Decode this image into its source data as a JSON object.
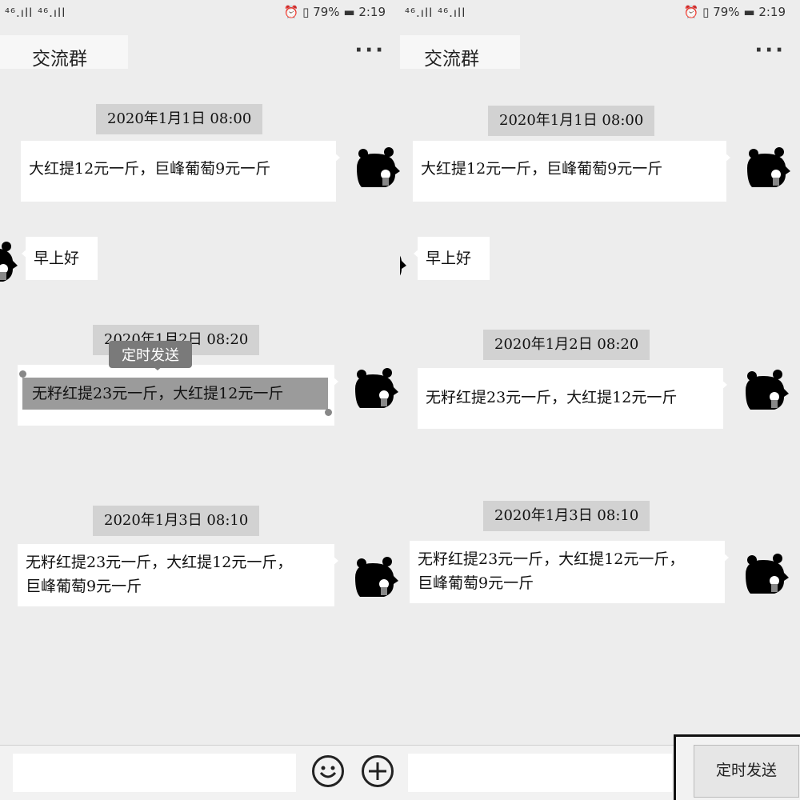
{
  "status": {
    "signal": "⁴⁶.ıll ⁴⁶.ıll",
    "battery_pct": "79%",
    "time": "2:19"
  },
  "chat": {
    "title": "交流群",
    "more_label": "···"
  },
  "timestamps": {
    "t1": "2020年1月1日 08:00",
    "t2": "2020年1月2日 08:20",
    "t3": "2020年1月3日 08:10"
  },
  "messages": {
    "m1": "大红提12元一斤，巨峰葡萄9元一斤",
    "m2": "早上好",
    "m3": "无籽红提23元一斤，大红提12元一斤",
    "m4_line1": "无籽红提23元一斤，大红提12元一斤，",
    "m4_line2": "巨峰葡萄9元一斤"
  },
  "context_menu": {
    "schedule_label": "定时发送"
  },
  "send_bar": {
    "schedule_button": "定时发送"
  },
  "colors": {
    "background": "#ededed",
    "bubble": "#ffffff",
    "timestamp_bg": "#d2d2d2",
    "selection": "#9b9b9b"
  }
}
